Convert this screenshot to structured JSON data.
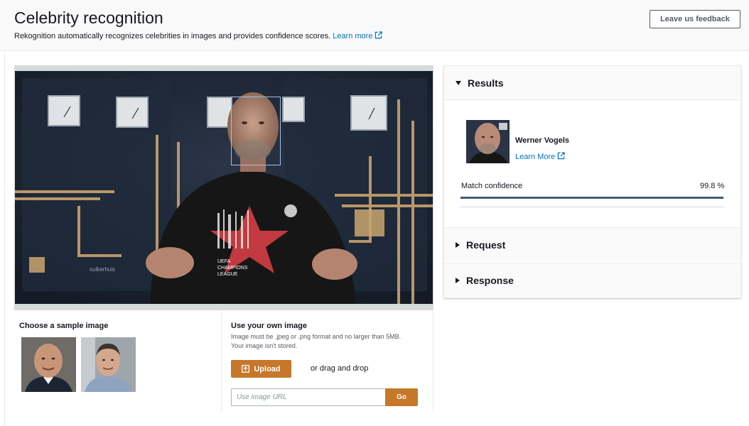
{
  "header": {
    "title": "Celebrity recognition",
    "subtitle": "Rekognition automatically recognizes celebrities in images and provides confidence scores.",
    "learn_more": "Learn more",
    "feedback_button": "Leave us feedback"
  },
  "sample": {
    "heading": "Choose a sample image"
  },
  "own_image": {
    "heading": "Use your own image",
    "description_line1": "Image must be .jpeg or .png format and no larger than 5MB.",
    "description_line2": "Your image isn't stored.",
    "upload_label": "Upload",
    "drag_text": "or drag and drop",
    "url_placeholder": "Use image URL",
    "go_label": "Go"
  },
  "results": {
    "section_title": "Results",
    "celebrity_name": "Werner Vogels",
    "learn_more": "Learn More",
    "confidence_label": "Match confidence",
    "confidence_value": "99.8 %",
    "confidence_fraction": 0.998,
    "request_title": "Request",
    "response_title": "Response"
  },
  "photo_text": {
    "shirt_line1": "UEFA",
    "shirt_line2": "CHAMPIONS",
    "shirt_line3": "LEAGUE",
    "wall_sign": "sulkerhuis"
  },
  "colors": {
    "accent_orange": "#c7772a",
    "link_blue": "#0073bb",
    "face_box": "#9ec3e6",
    "confidence_bar": "#44597a"
  },
  "icons": {
    "external_link": "external-link-icon",
    "upload": "upload-icon",
    "expanded": "caret-down-icon",
    "collapsed": "caret-right-icon"
  }
}
